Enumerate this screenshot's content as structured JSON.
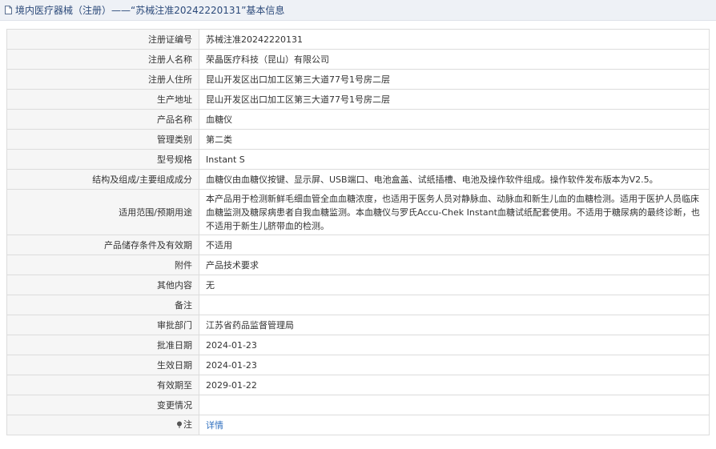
{
  "header": {
    "title": "境内医疗器械（注册）——“苏械注准20242220131”基本信息"
  },
  "rows": [
    {
      "label": "注册证编号",
      "value": "苏械注准20242220131"
    },
    {
      "label": "注册人名称",
      "value": "荣晶医疗科技（昆山）有限公司"
    },
    {
      "label": "注册人住所",
      "value": "昆山开发区出口加工区第三大道77号1号房二层"
    },
    {
      "label": "生产地址",
      "value": "昆山开发区出口加工区第三大道77号1号房二层"
    },
    {
      "label": "产品名称",
      "value": "血糖仪"
    },
    {
      "label": "管理类别",
      "value": "第二类"
    },
    {
      "label": "型号规格",
      "value": "Instant S"
    },
    {
      "label": "结构及组成/主要组成成分",
      "value": "血糖仪由血糖仪按键、显示屏、USB端口、电池盒盖、试纸插槽、电池及操作软件组成。操作软件发布版本为V2.5。"
    },
    {
      "label": "适用范围/预期用途",
      "value": "本产品用于检测新鲜毛细血管全血血糖浓度，也适用于医务人员对静脉血、动脉血和新生儿血的血糖检测。适用于医护人员临床血糖监测及糖尿病患者自我血糖监测。本血糖仪与罗氏Accu-Chek Instant血糖试纸配套使用。不适用于糖尿病的最终诊断，也不适用于新生儿脐带血的检测。"
    },
    {
      "label": "产品储存条件及有效期",
      "value": "不适用"
    },
    {
      "label": "附件",
      "value": "产品技术要求"
    },
    {
      "label": "其他内容",
      "value": "无"
    },
    {
      "label": "备注",
      "value": ""
    },
    {
      "label": "审批部门",
      "value": "江苏省药品监督管理局"
    },
    {
      "label": "批准日期",
      "value": "2024-01-23"
    },
    {
      "label": "生效日期",
      "value": "2024-01-23"
    },
    {
      "label": "有效期至",
      "value": "2029-01-22"
    },
    {
      "label": "变更情况",
      "value": ""
    }
  ],
  "note": {
    "label": "注",
    "link_text": "详情"
  }
}
